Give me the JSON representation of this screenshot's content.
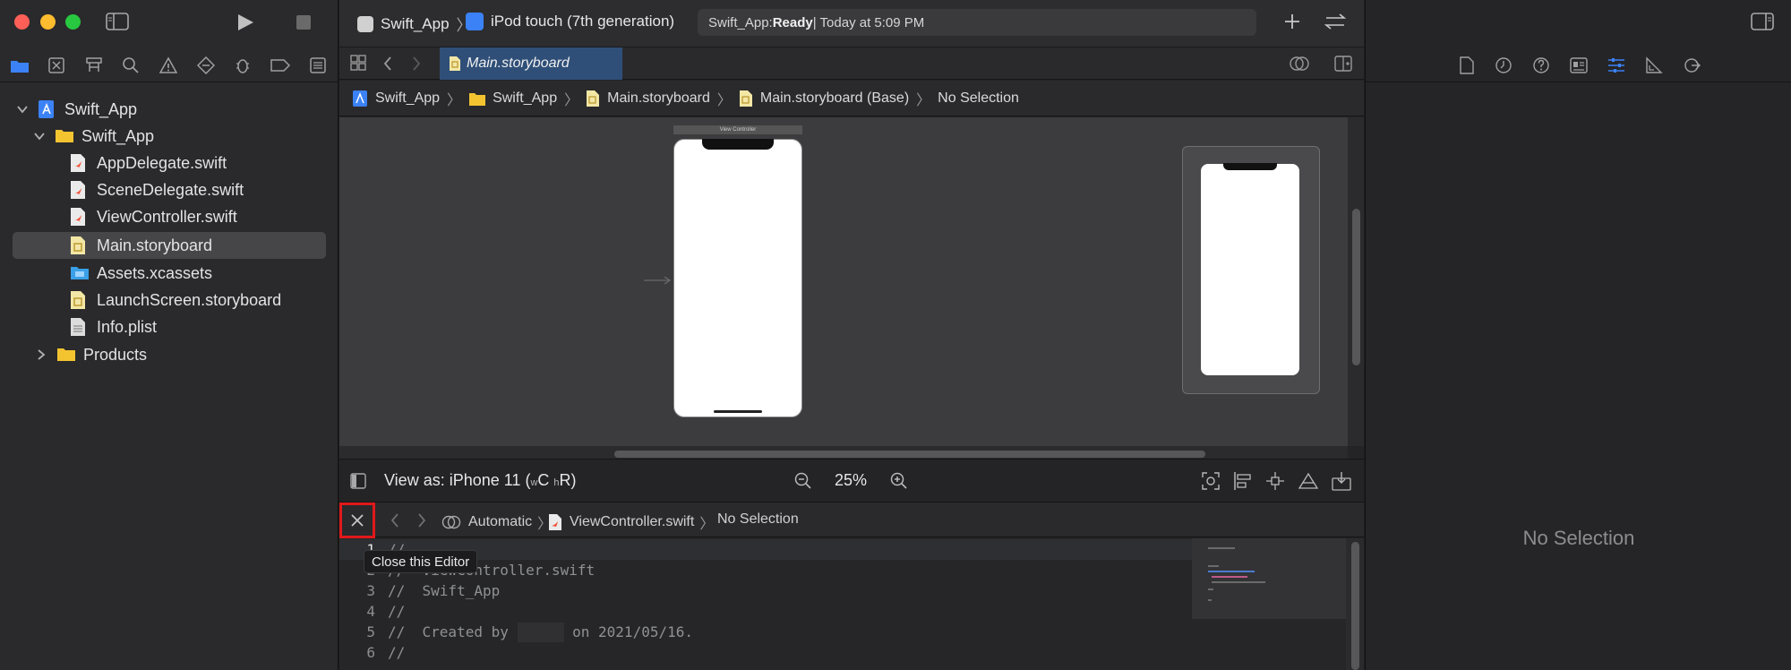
{
  "window": {
    "traffic_colors": [
      "#ff5f57",
      "#febc2e",
      "#28c840"
    ]
  },
  "toolbar": {
    "scheme_name": "Swift_App",
    "device_name": "iPod touch (7th generation)",
    "status_project": "Swift_App: ",
    "status_state": "Ready",
    "status_time": " | Today at 5:09 PM"
  },
  "navigator": {
    "tabs": [
      "folder-icon",
      "source-control-icon",
      "hierarchy-icon",
      "search-icon",
      "warning-icon",
      "test-icon",
      "debug-icon",
      "breakpoint-icon",
      "report-icon"
    ],
    "tree": [
      {
        "label": "Swift_App",
        "kind": "project",
        "expanded": true
      },
      {
        "label": "Swift_App",
        "kind": "folder",
        "expanded": true
      },
      {
        "label": "AppDelegate.swift",
        "kind": "swift"
      },
      {
        "label": "SceneDelegate.swift",
        "kind": "swift"
      },
      {
        "label": "ViewController.swift",
        "kind": "swift"
      },
      {
        "label": "Main.storyboard",
        "kind": "storyboard",
        "selected": true
      },
      {
        "label": "Assets.xcassets",
        "kind": "assets"
      },
      {
        "label": "LaunchScreen.storyboard",
        "kind": "storyboard"
      },
      {
        "label": "Info.plist",
        "kind": "plist"
      },
      {
        "label": "Products",
        "kind": "folder",
        "expanded": false
      }
    ]
  },
  "editor": {
    "active_tab": "Main.storyboard",
    "breadcrumbs": [
      "Swift_App",
      "Swift_App",
      "Main.storyboard",
      "Main.storyboard (Base)",
      "No Selection"
    ],
    "scene_title": "View Controller",
    "view_as_prefix": "View as: iPhone 11 (",
    "view_as_w": "w",
    "view_as_c": "C ",
    "view_as_h": "h",
    "view_as_r": "R)",
    "zoom": "25%"
  },
  "assistant": {
    "mode": "Automatic",
    "file": "ViewController.swift",
    "selection": "No Selection",
    "close_tooltip": "Close this Editor"
  },
  "code": [
    {
      "n": "1",
      "text": "//"
    },
    {
      "n": "2",
      "text": "//  ViewController.swift"
    },
    {
      "n": "3",
      "text": "//  Swift_App"
    },
    {
      "n": "4",
      "text": "//"
    },
    {
      "n": "5",
      "text_a": "//  Created by ",
      "text_b": " on 2021/05/16."
    },
    {
      "n": "6",
      "text": "//"
    }
  ],
  "inspector": {
    "tabs": [
      "file-icon",
      "history-icon",
      "help-icon",
      "identity-icon",
      "attributes-icon",
      "size-icon",
      "connections-icon"
    ],
    "empty_text": "No Selection"
  },
  "colors": {
    "accent": "#3b82f6",
    "highlight_box": "#e0191b",
    "tab_active_bg": "#2f4f78"
  }
}
